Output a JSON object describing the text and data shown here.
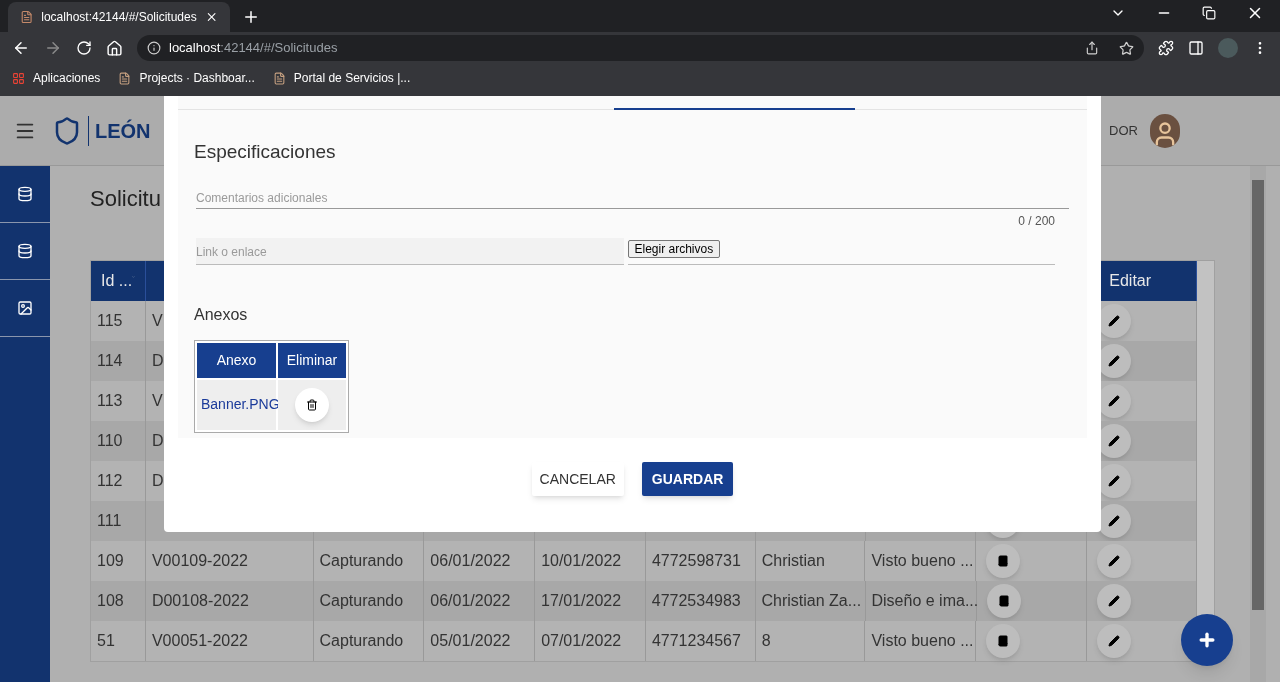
{
  "browser": {
    "tab_title": "localhost:42144/#/Solicitudes",
    "address": {
      "host": "localhost",
      "path": ":42144/#/Solicitudes"
    },
    "bookmarks": [
      "Aplicaciones",
      "Projects · Dashboar...",
      "Portal de Servicios |..."
    ]
  },
  "header": {
    "logo_text": "LEÓN",
    "user": "DOR"
  },
  "page": {
    "title": "Solicitu"
  },
  "table": {
    "id_column": "Id ...",
    "edit_column": "Editar",
    "rows": [
      {
        "cells": [
          "115",
          "V"
        ]
      },
      {
        "cells": [
          "114",
          "D"
        ]
      },
      {
        "cells": [
          "113",
          "V"
        ]
      },
      {
        "cells": [
          "110",
          "D"
        ]
      },
      {
        "cells": [
          "112",
          "D"
        ]
      },
      {
        "cells": [
          "111"
        ]
      },
      {
        "cells": [
          "109",
          "V00109-2022",
          "Capturando",
          "06/01/2022",
          "10/01/2022",
          "4772598731",
          "Christian",
          "Visto bueno ..."
        ]
      },
      {
        "cells": [
          "108",
          "D00108-2022",
          "Capturando",
          "06/01/2022",
          "17/01/2022",
          "4772534983",
          "Christian Za...",
          "Diseño e ima..."
        ]
      },
      {
        "cells": [
          "51",
          "V00051-2022",
          "Capturando",
          "05/01/2022",
          "07/01/2022",
          "4771234567",
          "8",
          "Visto bueno ..."
        ]
      }
    ]
  },
  "dialog": {
    "heading": "Especificaciones",
    "comment": {
      "placeholder": "Comentarios adicionales",
      "counter": "0 / 200"
    },
    "link": {
      "placeholder": "Link o enlace"
    },
    "file": {
      "button": "Elegir archivos"
    },
    "attachments": {
      "title": "Anexos",
      "columns": [
        "Anexo",
        "Eliminar"
      ],
      "rows": [
        {
          "name": "Banner.PNG"
        }
      ]
    },
    "buttons": {
      "cancel": "CANCELAR",
      "save": "GUARDAR"
    }
  }
}
